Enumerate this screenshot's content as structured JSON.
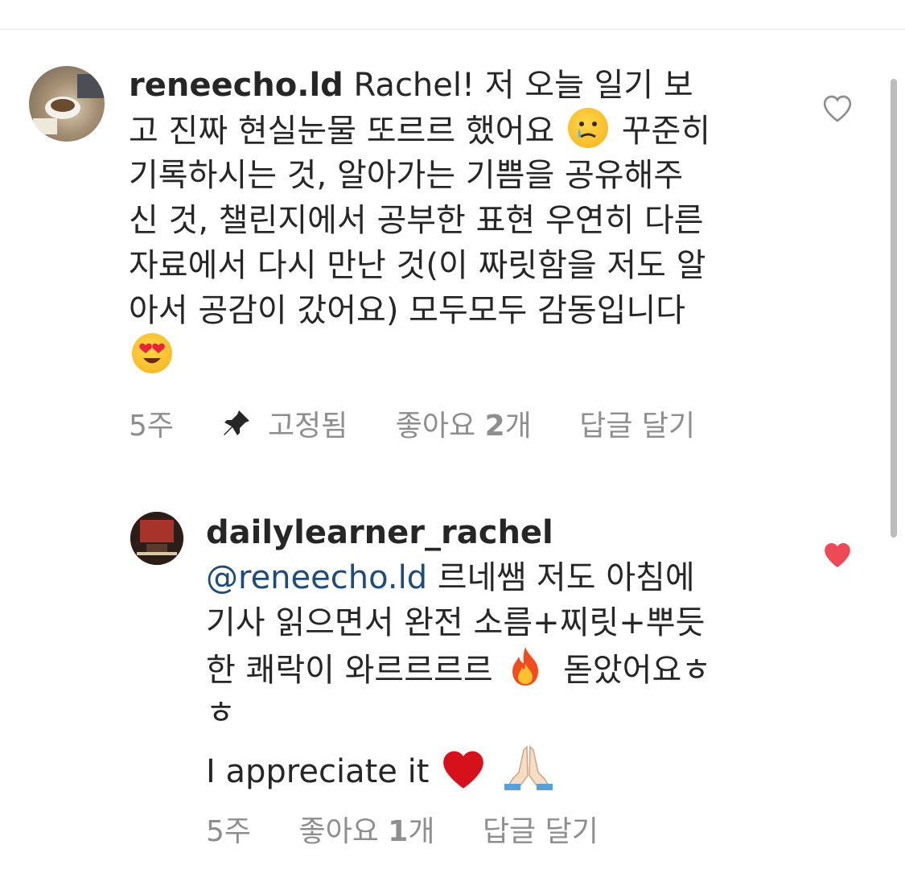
{
  "comments": [
    {
      "username": "reneecho.ld",
      "lines": [
        "Rachel! 저 오늘 일기 보",
        "고 진짜 현실눈물 또르르 했어요",
        "꾸준히",
        "기록하시는 것, 알아가는 기쁨을 공유해주",
        "신 것, 챌린지에서 공부한 표현 우연히 다른",
        "자료에서 다시 만난 것(이 짜릿함을 저도 알",
        "아서 공감이 갔어요) 모두모두 감동입니다"
      ],
      "time": "5주",
      "pinned_label": "고정됨",
      "likes": "좋아요 2개",
      "reply": "답글 달기",
      "liked": false
    },
    {
      "username": "dailylearner_rachel",
      "mention": "@reneecho.ld",
      "lines": [
        "르네쌤 저도 아침에",
        "기사 읽으면서 완전 소름+찌릿+뿌듯",
        "한 쾌락이 와르르르르",
        "돋았어요ㅎ",
        "ㅎ",
        "I appreciate it"
      ],
      "time": "5주",
      "likes": "좋아요 1개",
      "reply": "답글 달기",
      "liked": true
    }
  ],
  "colors": {
    "like_red": "#ed4956",
    "meta_gray": "#8e8e8e",
    "mention_blue": "#1e4b7a"
  },
  "icons": [
    "heart-outline-icon",
    "heart-filled-icon",
    "pin-icon"
  ]
}
